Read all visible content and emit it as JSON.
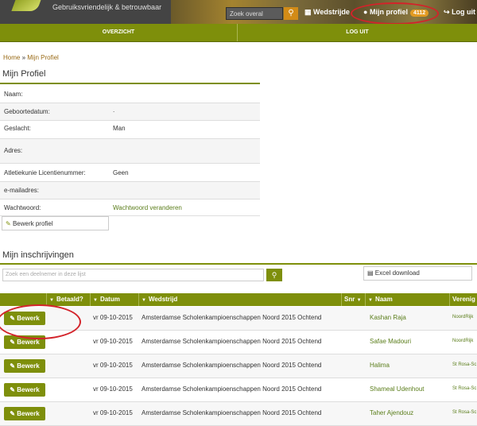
{
  "header": {
    "tagline": "Gebruiksvriendelijk & betrouwbaar",
    "search_placeholder": "Zoek overal",
    "search_icon": "search-icon",
    "wedstrijden_label": "Wedstrijde",
    "profile_label": "Mijn profiel",
    "profile_count": "4112",
    "logout_label": "Log uit"
  },
  "nav": {
    "overview_label": "OVERZICHT",
    "logout_label": "LOG UIT"
  },
  "breadcrumb": {
    "home": "Home",
    "sep": "»",
    "current": "Mijn Profiel"
  },
  "profile": {
    "title": "Mijn Profiel",
    "rows": [
      {
        "label": "Naam:",
        "value": ""
      },
      {
        "label": "Geboortedatum:",
        "value": "."
      },
      {
        "label": "Geslacht:",
        "value": "Man"
      },
      {
        "label": "Adres:",
        "value": ""
      },
      {
        "label": "Atletiekunie Licentienummer:",
        "value": "Geen"
      },
      {
        "label": "e-mailadres:",
        "value": ""
      },
      {
        "label": "Wachtwoord:",
        "value": "Wachtwoord veranderen"
      }
    ],
    "edit_label": "Bewerk profiel"
  },
  "registrations": {
    "title": "Mijn inschrijvingen",
    "filter_placeholder": "Zoek een deelnemer in deze lijst",
    "excel_label": "Excel download",
    "columns": [
      "Betaald?",
      "Datum",
      "Wedstrijd",
      "Snr",
      "Naam",
      "Verenig"
    ],
    "rows": [
      {
        "button": "Bewerk",
        "date": "vr 09-10-2015",
        "event": "Amsterdamse Scholenkampioenschappen Noord 2015 Ochtend",
        "name": "Kashan Raja",
        "club": "NoordRijk"
      },
      {
        "button": "Bewerk",
        "date": "vr 09-10-2015",
        "event": "Amsterdamse Scholenkampioenschappen Noord 2015 Ochtend",
        "name": "Safae Madouri",
        "club": "NoordRijk"
      },
      {
        "button": "Bewerk",
        "date": "vr 09-10-2015",
        "event": "Amsterdamse Scholenkampioenschappen Noord 2015 Ochtend",
        "name": "Halima",
        "club": "St Rosa-Sc"
      },
      {
        "button": "Bewerk",
        "date": "vr 09-10-2015",
        "event": "Amsterdamse Scholenkampioenschappen Noord 2015 Ochtend",
        "name": "Shameal Udenhout",
        "club": "St Rosa-Sc"
      },
      {
        "button": "Bewerk",
        "date": "vr 09-10-2015",
        "event": "Amsterdamse Scholenkampioenschappen Noord 2015 Ochtend",
        "name": "Taher Ajendouz",
        "club": "St Rosa-Sc"
      }
    ]
  },
  "colors": {
    "accent": "#7e8f0b",
    "badge": "#e39b22",
    "highlight": "#d3232a"
  }
}
